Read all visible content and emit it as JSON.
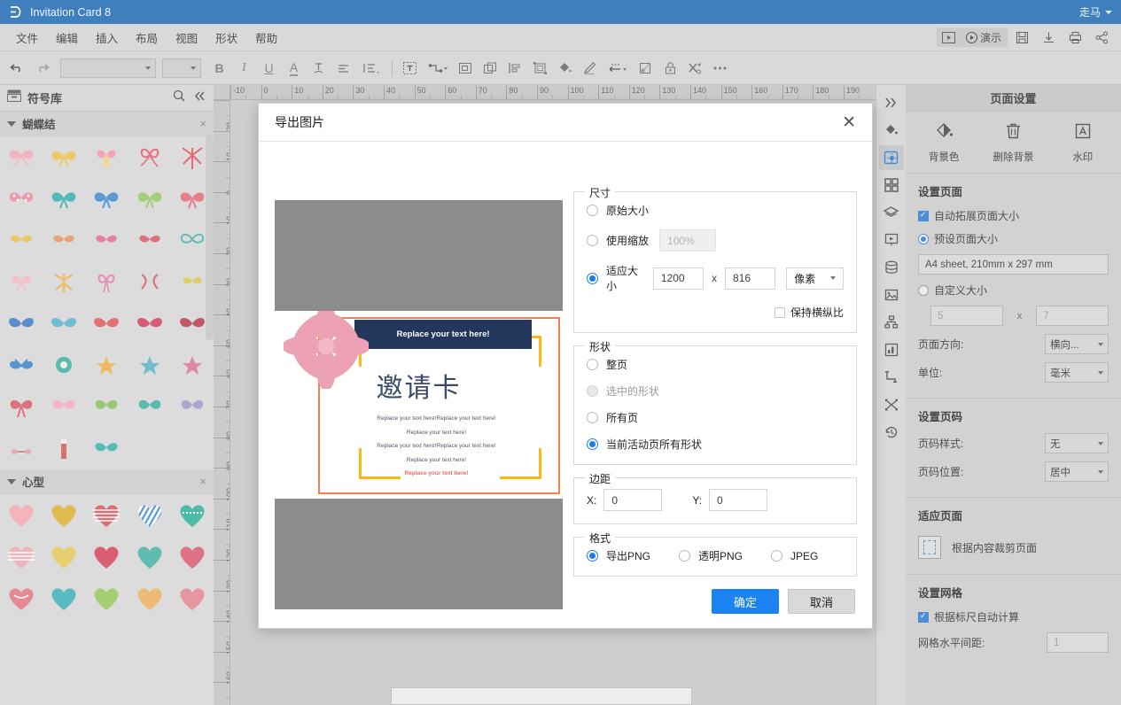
{
  "titlebar": {
    "app_title": "Invitation Card 8",
    "user": "走马",
    "logo_icon": "app-logo-icon"
  },
  "menubar": {
    "items": [
      {
        "label": "文件"
      },
      {
        "label": "编辑"
      },
      {
        "label": "插入"
      },
      {
        "label": "布局"
      },
      {
        "label": "视图"
      },
      {
        "label": "形状"
      },
      {
        "label": "帮助"
      }
    ],
    "right_actions": [
      {
        "name": "slideshow-icon",
        "label": ""
      },
      {
        "name": "present-icon",
        "label": "演示"
      },
      {
        "name": "save-icon",
        "label": ""
      },
      {
        "name": "download-icon",
        "label": ""
      },
      {
        "name": "print-icon",
        "label": ""
      },
      {
        "name": "share-icon",
        "label": ""
      }
    ]
  },
  "toolbar": {
    "font_family_value": "",
    "font_size_value": "",
    "bold_label": "B",
    "italic_label": "I",
    "underline_label": "U",
    "font_color_label": "A",
    "icons": [
      "undo-icon",
      "redo-icon",
      "strikethrough-icon",
      "align-icon",
      "line-spacing-icon",
      "text-box-icon",
      "connector-icon",
      "group-icon",
      "duplicate-icon",
      "align-left-icon",
      "arrange-icon",
      "fill-icon",
      "pen-icon",
      "line-style-icon",
      "shadow-icon",
      "lock-icon",
      "tools-icon",
      "more-icon"
    ]
  },
  "left_panel": {
    "header_title": "符号库",
    "header_icons": [
      "library-icon",
      "search-icon",
      "collapse-icon"
    ],
    "categories": [
      {
        "name": "蝴蝶结",
        "close_label": "×"
      },
      {
        "name": "心型",
        "close_label": "×"
      }
    ]
  },
  "canvas": {
    "ruler_h_ticks": [
      "-10",
      "0",
      "10",
      "20",
      "30",
      "40",
      "50",
      "60",
      "70",
      "80",
      "90",
      "100",
      "110",
      "120",
      "130",
      "140",
      "150",
      "160",
      "170",
      "180",
      "190"
    ],
    "ruler_v_ticks": [
      "-30",
      "-20",
      "-10",
      "0",
      "10",
      "20",
      "30",
      "40",
      "50",
      "60",
      "70",
      "80",
      "90",
      "100",
      "110",
      "120",
      "130",
      "140",
      "150",
      "160"
    ]
  },
  "right_rail": {
    "icons": [
      {
        "name": "expand-chevrons-icon",
        "active": false
      },
      {
        "name": "fill-bucket-icon",
        "active": false
      },
      {
        "name": "page-settings-icon",
        "active": true
      },
      {
        "name": "grid-apps-icon",
        "active": false
      },
      {
        "name": "layers-icon",
        "active": false
      },
      {
        "name": "presentation-icon",
        "active": false
      },
      {
        "name": "database-icon",
        "active": false
      },
      {
        "name": "image-icon",
        "active": false
      },
      {
        "name": "hierarchy-icon",
        "active": false
      },
      {
        "name": "chart-icon",
        "active": false
      },
      {
        "name": "flow-icon",
        "active": false
      },
      {
        "name": "shuffle-icon",
        "active": false
      },
      {
        "name": "history-icon",
        "active": false
      }
    ]
  },
  "right_panel": {
    "title": "页面设置",
    "quick_actions": [
      {
        "icon": "paint-bucket-icon",
        "label": "背景色"
      },
      {
        "icon": "trash-icon",
        "label": "删除背景"
      },
      {
        "icon": "watermark-icon",
        "label": "水印"
      }
    ],
    "page_section": {
      "heading": "设置页面",
      "auto_expand": {
        "label": "自动拓展页面大小",
        "checked": true
      },
      "preset_size": {
        "label": "预设页面大小",
        "selected": true,
        "value": "A4 sheet, 210mm x 297 mm"
      },
      "custom_size": {
        "label": "自定义大小",
        "selected": false,
        "width": "5",
        "height": "7",
        "x_symbol": "x"
      },
      "orientation": {
        "label": "页面方向:",
        "value": "横向..."
      },
      "unit": {
        "label": "单位:",
        "value": "毫米"
      }
    },
    "pagenum_section": {
      "heading": "设置页码",
      "style": {
        "label": "页码样式:",
        "value": "无"
      },
      "position": {
        "label": "页码位置:",
        "value": "居中"
      }
    },
    "fitpage_section": {
      "heading": "适应页面",
      "crop_label": "根据内容裁剪页面",
      "crop_icon": "crop-page-icon"
    },
    "grid_section": {
      "heading": "设置网格",
      "auto_ruler": {
        "label": "根据标尺自动计算",
        "checked": true
      },
      "h_spacing": {
        "label": "网格水平间距:",
        "value": "1"
      }
    }
  },
  "dialog": {
    "title": "导出图片",
    "close_label": "✕",
    "preview": {
      "banner_text": "Replace your text here!",
      "card_title": "邀请卡",
      "lines": [
        "Replace your text here!Replace your text here!",
        "Replace your text here!",
        "Replace your text here!Replace your text here!",
        "Replace your text here!",
        "Replace your text here!"
      ],
      "accent_line_index": 4,
      "flower_icon": "flower-decoration-icon",
      "accent_color": "#f0675a",
      "border_color": "#f0814e",
      "bracket_color": "#fdb913",
      "banner_color": "#23365c"
    },
    "size_group": {
      "legend": "尺寸",
      "original": {
        "label": "原始大小",
        "selected": false
      },
      "scale": {
        "label": "使用缩放",
        "selected": false,
        "value": "100%",
        "disabled": true
      },
      "fit": {
        "label": "适应大小",
        "selected": true,
        "width": "1200",
        "height": "816",
        "x_symbol": "x",
        "unit": "像素"
      },
      "keep_ratio": {
        "label": "保持横纵比",
        "checked": false
      }
    },
    "shape_group": {
      "legend": "形状",
      "options": [
        {
          "label": "整页",
          "selected": false,
          "disabled": false
        },
        {
          "label": "选中的形状",
          "selected": false,
          "disabled": true
        },
        {
          "label": "所有页",
          "selected": false,
          "disabled": false
        },
        {
          "label": "当前活动页所有形状",
          "selected": true,
          "disabled": false
        }
      ]
    },
    "margin_group": {
      "legend": "边距",
      "x_label": "X:",
      "x_value": "0",
      "y_label": "Y:",
      "y_value": "0"
    },
    "format_group": {
      "legend": "格式",
      "options": [
        {
          "label": "导出PNG",
          "selected": true
        },
        {
          "label": "透明PNG",
          "selected": false
        },
        {
          "label": "JPEG",
          "selected": false
        }
      ]
    },
    "confirm_label": "确定",
    "cancel_label": "取消"
  }
}
